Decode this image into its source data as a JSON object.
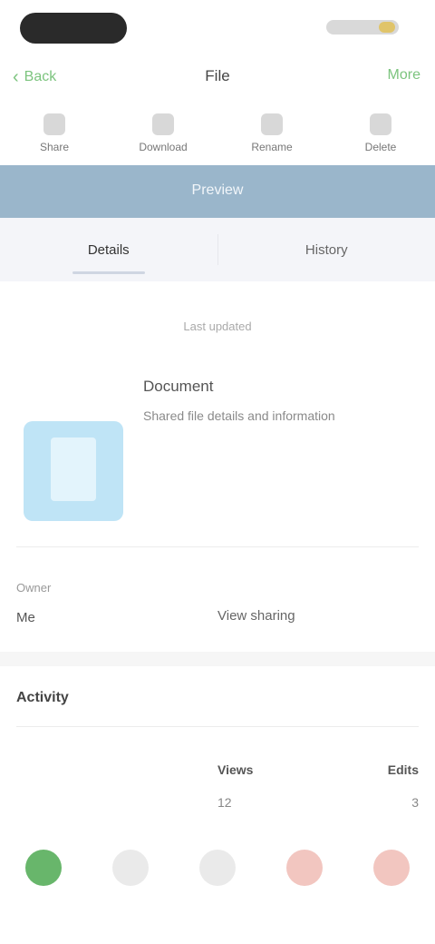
{
  "status_bar": {
    "time": ""
  },
  "nav": {
    "back_label": "Back",
    "title": "File",
    "action_label": "More"
  },
  "toolbar": [
    {
      "label": "Share",
      "icon": "share-icon"
    },
    {
      "label": "Download",
      "icon": "download-icon"
    },
    {
      "label": "Rename",
      "icon": "edit-icon"
    },
    {
      "label": "Delete",
      "icon": "trash-icon"
    }
  ],
  "banner": {
    "text": "Preview"
  },
  "tabs": [
    {
      "label": "Details",
      "active": true
    },
    {
      "label": "History",
      "active": false
    }
  ],
  "subcaption": "Last updated",
  "document": {
    "name": "Document",
    "description": "Shared file details and information",
    "thumb_color": "#bfe4f6"
  },
  "meta": {
    "label": "Owner",
    "value": "Me",
    "link": "View sharing"
  },
  "section": {
    "title": "Activity"
  },
  "stats": [
    {
      "key": "Views",
      "value": "12"
    },
    {
      "key": "Edits",
      "value": "3"
    }
  ],
  "bottom_bar": [
    {
      "label": "",
      "icon": "home-icon",
      "color": "#68b66b"
    },
    {
      "label": "",
      "icon": "files-icon",
      "color": "#eaeaea"
    },
    {
      "label": "",
      "icon": "plus-icon",
      "color": "#eaeaea"
    },
    {
      "label": "",
      "icon": "alert-icon",
      "color": "#f2c6c0"
    },
    {
      "label": "",
      "icon": "profile-icon",
      "color": "#f2c6c0"
    }
  ],
  "colors": {
    "accent": "#7cc47e",
    "banner": "#9ab6cb",
    "tab_bg": "#f4f5f9"
  }
}
